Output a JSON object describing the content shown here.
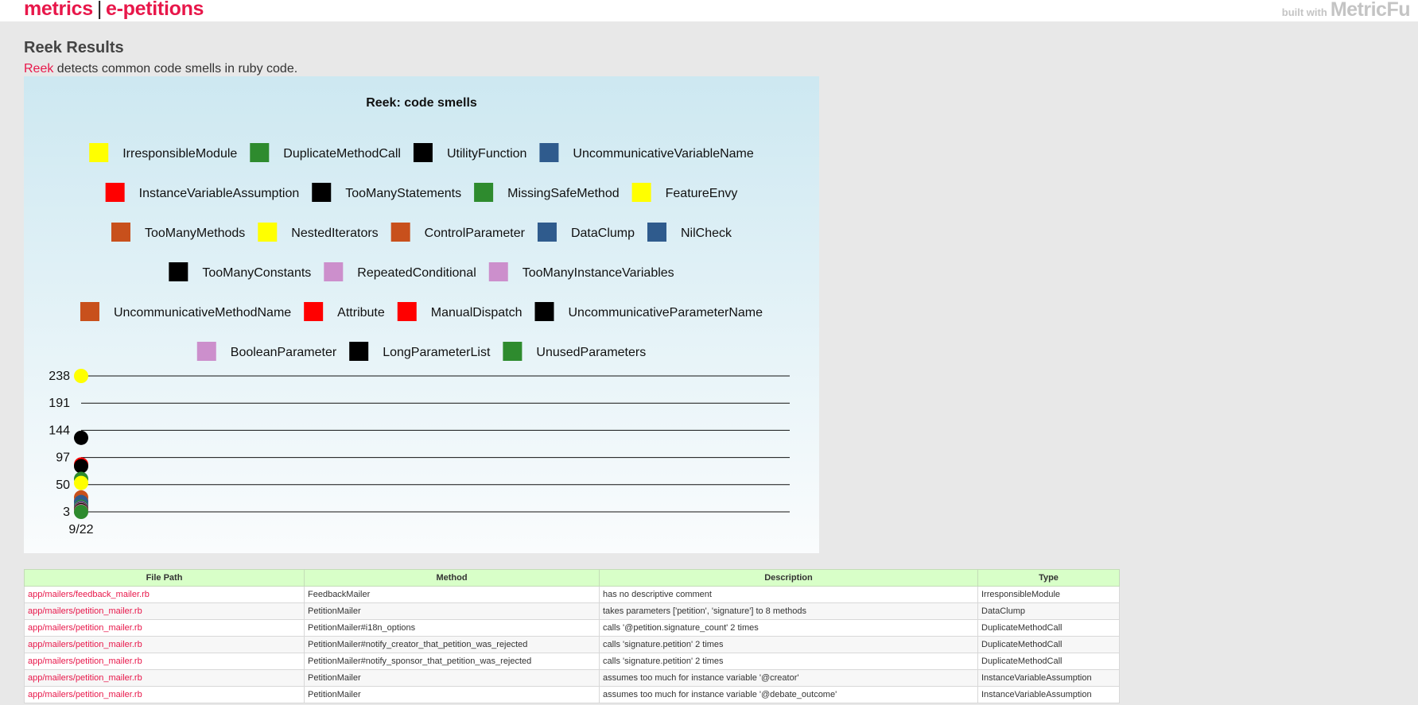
{
  "header": {
    "brand_left": "metrics",
    "brand_sep": "|",
    "brand_right": "e-petitions",
    "built_small": "built with",
    "built_big": "MetricFu"
  },
  "page": {
    "title": "Reek Results",
    "intro_link": "Reek",
    "intro_text": " detects common code smells in ruby code."
  },
  "chart_data": {
    "type": "line",
    "title": "Reek: code smells",
    "x": [
      "9/22"
    ],
    "y_ticks": [
      238,
      191,
      144,
      97,
      50,
      3
    ],
    "ylim": [
      3,
      238
    ],
    "legend_placement": "top",
    "legend_rows": [
      [
        0,
        1,
        2,
        3
      ],
      [
        4,
        5,
        6,
        7
      ],
      [
        8,
        9,
        10,
        11,
        12
      ],
      [
        13,
        14,
        15
      ],
      [
        16,
        17,
        18,
        19
      ],
      [
        20,
        21,
        22
      ]
    ],
    "series": [
      {
        "name": "IrresponsibleModule",
        "color": "#ffff00",
        "values": [
          238
        ]
      },
      {
        "name": "DuplicateMethodCall",
        "color": "#2e8b2e",
        "values": [
          12
        ]
      },
      {
        "name": "UtilityFunction",
        "color": "#000000",
        "values": [
          131
        ]
      },
      {
        "name": "UncommunicativeVariableName",
        "color": "#2f5b8d",
        "values": [
          20
        ]
      },
      {
        "name": "InstanceVariableAssumption",
        "color": "#ff0000",
        "values": [
          85
        ]
      },
      {
        "name": "TooManyStatements",
        "color": "#000000",
        "values": [
          82
        ]
      },
      {
        "name": "MissingSafeMethod",
        "color": "#2e8b2e",
        "values": [
          60
        ]
      },
      {
        "name": "FeatureEnvy",
        "color": "#ffff00",
        "values": [
          53
        ]
      },
      {
        "name": "TooManyMethods",
        "color": "#c8501c",
        "values": [
          28
        ]
      },
      {
        "name": "NestedIterators",
        "color": "#ffff00",
        "values": [
          6
        ]
      },
      {
        "name": "ControlParameter",
        "color": "#c8501c",
        "values": [
          22
        ]
      },
      {
        "name": "DataClump",
        "color": "#2f5b8d",
        "values": [
          15
        ]
      },
      {
        "name": "NilCheck",
        "color": "#2f5b8d",
        "values": [
          10
        ]
      },
      {
        "name": "TooManyConstants",
        "color": "#000000",
        "values": [
          8
        ]
      },
      {
        "name": "RepeatedConditional",
        "color": "#cc8fcc",
        "values": [
          9
        ]
      },
      {
        "name": "TooManyInstanceVariables",
        "color": "#cc8fcc",
        "values": [
          7
        ]
      },
      {
        "name": "UncommunicativeMethodName",
        "color": "#c8501c",
        "values": [
          5
        ]
      },
      {
        "name": "Attribute",
        "color": "#ff0000",
        "values": [
          4
        ]
      },
      {
        "name": "ManualDispatch",
        "color": "#ff0000",
        "values": [
          4
        ]
      },
      {
        "name": "UncommunicativeParameterName",
        "color": "#000000",
        "values": [
          5
        ]
      },
      {
        "name": "BooleanParameter",
        "color": "#cc8fcc",
        "values": [
          4
        ]
      },
      {
        "name": "LongParameterList",
        "color": "#000000",
        "values": [
          6
        ]
      },
      {
        "name": "UnusedParameters",
        "color": "#2e8b2e",
        "values": [
          3
        ]
      }
    ]
  },
  "table": {
    "headers": [
      "File Path",
      "Method",
      "Description",
      "Type"
    ],
    "rows": [
      [
        "app/mailers/feedback_mailer.rb",
        "FeedbackMailer",
        "has no descriptive comment",
        "IrresponsibleModule"
      ],
      [
        "app/mailers/petition_mailer.rb",
        "PetitionMailer",
        "takes parameters ['petition', 'signature'] to 8 methods",
        "DataClump"
      ],
      [
        "app/mailers/petition_mailer.rb",
        "PetitionMailer#i18n_options",
        "calls '@petition.signature_count' 2 times",
        "DuplicateMethodCall"
      ],
      [
        "app/mailers/petition_mailer.rb",
        "PetitionMailer#notify_creator_that_petition_was_rejected",
        "calls 'signature.petition' 2 times",
        "DuplicateMethodCall"
      ],
      [
        "app/mailers/petition_mailer.rb",
        "PetitionMailer#notify_sponsor_that_petition_was_rejected",
        "calls 'signature.petition' 2 times",
        "DuplicateMethodCall"
      ],
      [
        "app/mailers/petition_mailer.rb",
        "PetitionMailer",
        "assumes too much for instance variable '@creator'",
        "InstanceVariableAssumption"
      ],
      [
        "app/mailers/petition_mailer.rb",
        "PetitionMailer",
        "assumes too much for instance variable '@debate_outcome'",
        "InstanceVariableAssumption"
      ]
    ]
  }
}
